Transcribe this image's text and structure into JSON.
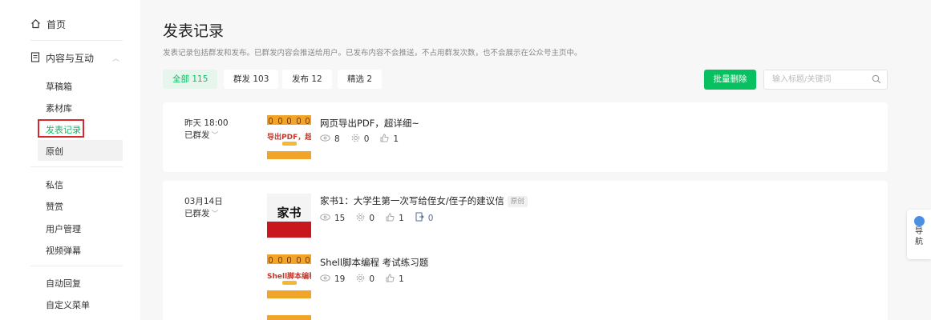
{
  "sidebar": {
    "home": "首页",
    "section": "内容与互动",
    "items": [
      {
        "label": "草稿箱"
      },
      {
        "label": "素材库"
      },
      {
        "label": "发表记录"
      },
      {
        "label": "原创"
      },
      {
        "label": "私信"
      },
      {
        "label": "赞赏"
      },
      {
        "label": "用户管理"
      },
      {
        "label": "视频弹幕"
      },
      {
        "label": "自动回复"
      },
      {
        "label": "自定义菜单"
      }
    ]
  },
  "header": {
    "title": "发表记录",
    "description": "发表记录包括群发和发布。已群发内容会推送给用户。已发布内容不会推送，不占用群发次数，也不会展示在公众号主页中。"
  },
  "tabs": [
    {
      "label": "全部 115"
    },
    {
      "label": "群发 103"
    },
    {
      "label": "发布 12"
    },
    {
      "label": "精选 2"
    }
  ],
  "toolbar": {
    "batch_delete": "批量删除",
    "search_placeholder": "输入标题/关键词"
  },
  "records": [
    {
      "time": "昨天 18:00",
      "status": "已群发",
      "articles": [
        {
          "thumb_text": "导出PDF，超详",
          "title": "网页导出PDF，超详细~",
          "views": "8",
          "shares": "0",
          "likes": "1"
        }
      ]
    },
    {
      "time": "03月14日",
      "status": "已群发",
      "articles": [
        {
          "thumb_text": "家书",
          "title": "家书1：大学生第一次写给侄女/侄子的建议信",
          "badge": "原创",
          "views": "15",
          "shares": "0",
          "likes": "1",
          "reposts": "0"
        },
        {
          "thumb_text": "Shell脚本编程",
          "title": "Shell脚本编程 考试练习题",
          "views": "19",
          "shares": "0",
          "likes": "1"
        }
      ]
    }
  ],
  "floatnav": {
    "line1": "导",
    "line2": "航"
  },
  "colors": {
    "accent": "#07c160",
    "highlight_box": "#d9272e",
    "link_blue": "#576b95"
  }
}
